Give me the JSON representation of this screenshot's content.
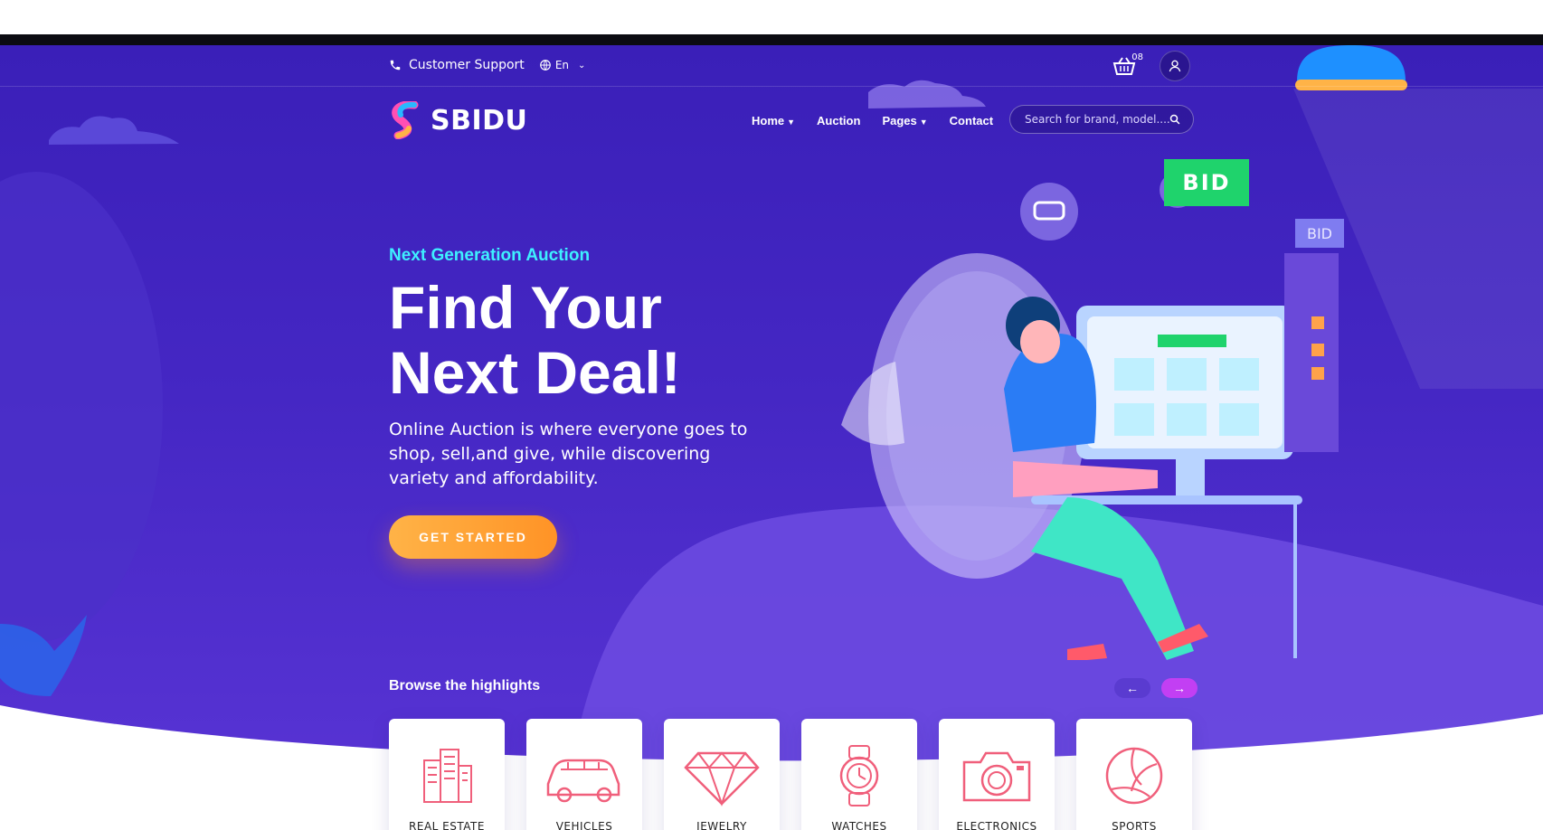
{
  "topbar": {
    "support_label": "Customer Support",
    "language": "En",
    "cart_count": "08"
  },
  "nav": {
    "brand": "SBIDU",
    "links": [
      {
        "label": "Home",
        "dropdown": true
      },
      {
        "label": "Auction",
        "dropdown": false
      },
      {
        "label": "Pages",
        "dropdown": true
      },
      {
        "label": "Contact",
        "dropdown": false
      }
    ],
    "search_placeholder": "Search for brand, model...."
  },
  "hero": {
    "subtitle": "Next Generation Auction",
    "headline_line1": "Find Your",
    "headline_line2": "Next Deal!",
    "description": "Online Auction is where everyone goes to shop, sell,and give, while discovering variety and affordability.",
    "cta_label": "GET STARTED"
  },
  "illustration": {
    "bid_main": "BID",
    "bid_tag": "BID"
  },
  "highlights": {
    "title": "Browse the highlights",
    "prev_arrow": "←",
    "next_arrow": "→",
    "categories": [
      {
        "label": "REAL ESTATE",
        "icon": "building-icon"
      },
      {
        "label": "VEHICLES",
        "icon": "car-icon"
      },
      {
        "label": "JEWELRY",
        "icon": "diamond-icon"
      },
      {
        "label": "WATCHES",
        "icon": "watch-icon"
      },
      {
        "label": "ELECTRONICS",
        "icon": "camera-icon"
      },
      {
        "label": "SPORTS",
        "icon": "volleyball-icon"
      }
    ]
  },
  "colors": {
    "hero_bg": "#4527c4",
    "accent_cyan": "#3ef0ff",
    "cta_orange": "#ff9f33",
    "bid_green": "#1fd36c",
    "icon_pink": "#f05f7b"
  }
}
